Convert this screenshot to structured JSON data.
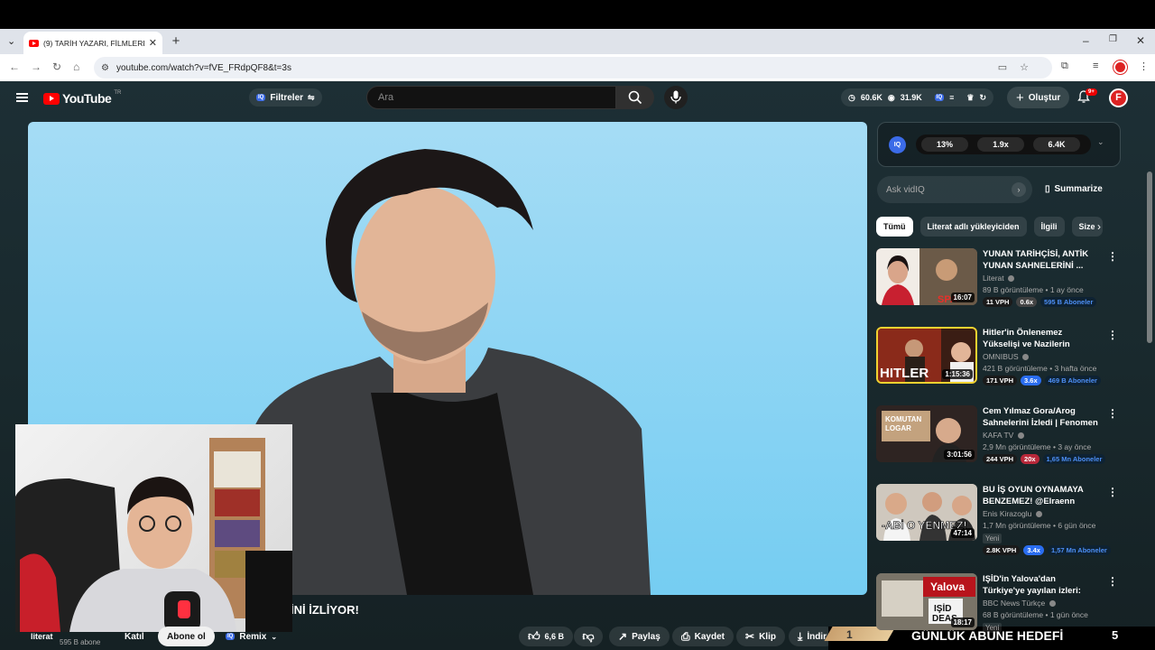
{
  "browser": {
    "tab_title": "(9) TARİH YAZARI, FİLMLERDEKİ",
    "url": "youtube.com/watch?v=fVE_FRdpQF8&t=3s"
  },
  "masthead": {
    "logo_text": "YouTube",
    "country_code": "TR",
    "filters_label": "Filtreler",
    "search_placeholder": "Ara",
    "stat_views": "60.6K",
    "stat_subs": "31.9K",
    "create_label": "Oluştur",
    "notifications_badge": "9+"
  },
  "player": {
    "subtitle": "İNİ İZLİYOR!"
  },
  "actions": {
    "channel_name": "literat",
    "channel_subs": "595 B abone",
    "join_label": "Katıl",
    "subscribe_label": "Abone ol",
    "remix_label": "Remix",
    "likes": "6,6 B",
    "share_label": "Paylaş",
    "save_label": "Kaydet",
    "clip_label": "Klip",
    "download_label": "İndir"
  },
  "goal_banner": {
    "left_count": "1",
    "label": "GÜNLÜK ABUNE HEDEFİ",
    "right_count": "5"
  },
  "vidiq": {
    "badge": "IQ",
    "metric1": "13%",
    "metric2": "1.9x",
    "metric3": "6.4K",
    "ask_placeholder": "Ask vidIQ",
    "summarize_label": "Summarize"
  },
  "chips": [
    "Tümü",
    "Literat adlı yükleyiciden",
    "İlgili",
    "Size"
  ],
  "recommendations": [
    {
      "title": "YUNAN TARİHÇİSİ, ANTİK YUNAN SAHNELERİNİ ...",
      "channel": "Literat",
      "views": "89 B görüntüleme",
      "age": "1 ay önce",
      "duration": "16:07",
      "vph": "11 VPH",
      "multiplier": "0.6x",
      "subscribers": "595 B Aboneler",
      "is_new": ""
    },
    {
      "title": "Hitler'in Önlenemez Yükselişi ve Nazilerin İktidara Gelmesi / ...",
      "channel": "OMNIBUS",
      "views": "421 B görüntüleme",
      "age": "3 hafta önce",
      "duration": "1:15:36",
      "vph": "171 VPH",
      "multiplier": "3.6x",
      "subscribers": "469 B Aboneler",
      "is_new": ""
    },
    {
      "title": "Cem Yılmaz Gora/Arog Sahnelerini İzledi | Fenomen ...",
      "channel": "KAFA TV",
      "views": "2,9 Mn görüntüleme",
      "age": "3 ay önce",
      "duration": "3:01:56",
      "vph": "244 VPH",
      "multiplier": "20x",
      "subscribers": "1,65 Mn Aboneler",
      "is_new": ""
    },
    {
      "title": "BU İŞ OYUN OYNAMAYA BENZEMEZ! @Elraenn YEMEK ...",
      "channel": "Enis Kirazoglu",
      "views": "1,7 Mn görüntüleme",
      "age": "6 gün önce",
      "duration": "47:14",
      "vph": "2.8K VPH",
      "multiplier": "3.4x",
      "subscribers": "1,57 Mn Aboneler",
      "is_new": "Yeni"
    },
    {
      "title": "IŞİD'in Yalova'dan Türkiye'ye yayılan izleri: BBC Türkçe ...",
      "channel": "BBC News Türkçe",
      "views": "68 B görüntüleme",
      "age": "1 gün önce",
      "duration": "18:17",
      "vph": "",
      "multiplier": "",
      "subscribers": "",
      "is_new": "Yeni"
    }
  ]
}
